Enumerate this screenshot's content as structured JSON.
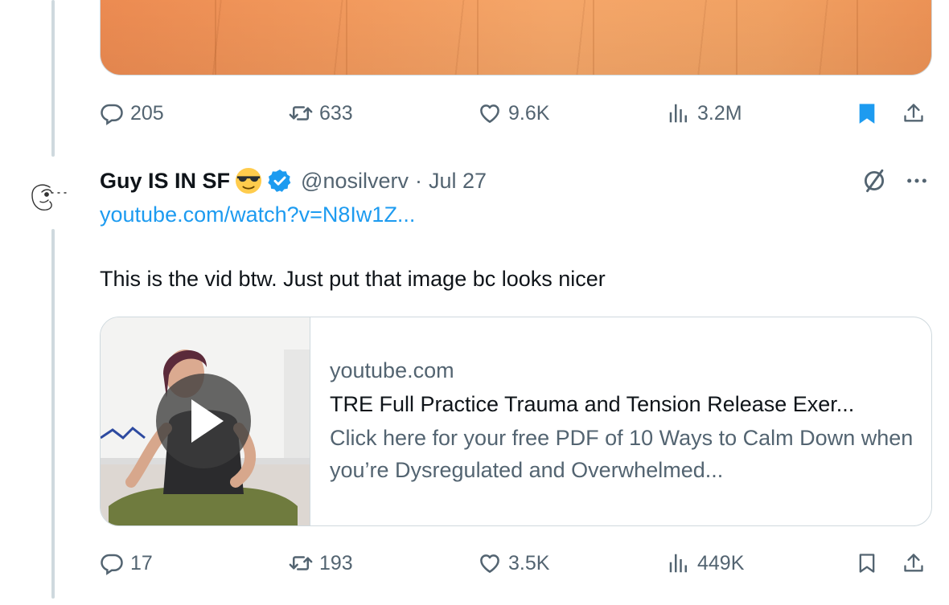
{
  "tweet1": {
    "stats": {
      "replies": "205",
      "retweets": "633",
      "likes": "9.6K",
      "views": "3.2M"
    },
    "bookmarked": true
  },
  "tweet2": {
    "author": {
      "display_name": "Guy IS IN SF",
      "emoji": "sunglasses-emoji",
      "verified": true,
      "handle": "@nosilverv",
      "date_sep": "·",
      "date": "Jul 27"
    },
    "link": "youtube.com/watch?v=N8Iw1Z...",
    "text": "This is the vid btw. Just put that image bc looks nicer",
    "card": {
      "domain": "youtube.com",
      "title": "TRE Full Practice Trauma and Tension Release Exer...",
      "description": "Click here for your free PDF of 10 Ways to Calm Down when you’re Dysregulated and Overwhelmed..."
    },
    "stats": {
      "replies": "17",
      "retweets": "193",
      "likes": "3.5K",
      "views": "449K"
    },
    "bookmarked": false
  },
  "colors": {
    "accent": "#1d9bf0",
    "muted": "#536471",
    "text": "#0f1419",
    "border": "#cfd9de"
  }
}
